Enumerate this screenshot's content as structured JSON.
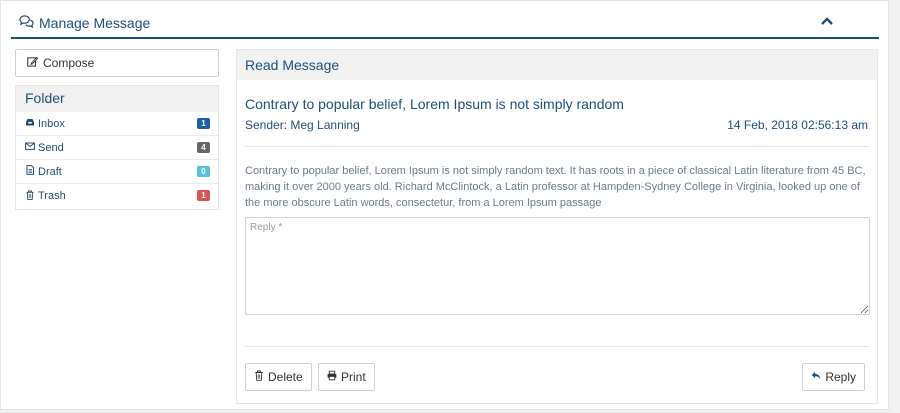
{
  "header": {
    "title": "Manage Message"
  },
  "sidebar": {
    "compose_label": "Compose",
    "folder_title": "Folder",
    "folders": [
      {
        "label": "Inbox",
        "count": "1",
        "badge_color": "#1f5fa6"
      },
      {
        "label": "Send",
        "count": "4",
        "badge_color": "#666666"
      },
      {
        "label": "Draft",
        "count": "0",
        "badge_color": "#5bc0de"
      },
      {
        "label": "Trash",
        "count": "1",
        "badge_color": "#d9534f"
      }
    ]
  },
  "message": {
    "panel_title": "Read Message",
    "subject": "Contrary to popular belief, Lorem Ipsum is not simply random",
    "sender": "Sender: Meg Lanning",
    "datetime": "14 Feb, 2018 02:56:13 am",
    "body": "Contrary to popular belief, Lorem Ipsum is not simply random text. It has roots in a piece of classical Latin literature from 45 BC, making it over 2000 years old. Richard McClintock, a Latin professor at Hampden-Sydney College in Virginia, looked up one of the more obscure Latin words, consectetur, from a Lorem Ipsum passage",
    "reply_placeholder": "Reply *",
    "reply_value": ""
  },
  "actions": {
    "delete_label": "Delete",
    "print_label": "Print",
    "reply_label": "Reply"
  },
  "colors": {
    "accent": "#1f4e79",
    "panel_header_bg": "#f1f1f1",
    "body_text": "#6a7a8c"
  }
}
